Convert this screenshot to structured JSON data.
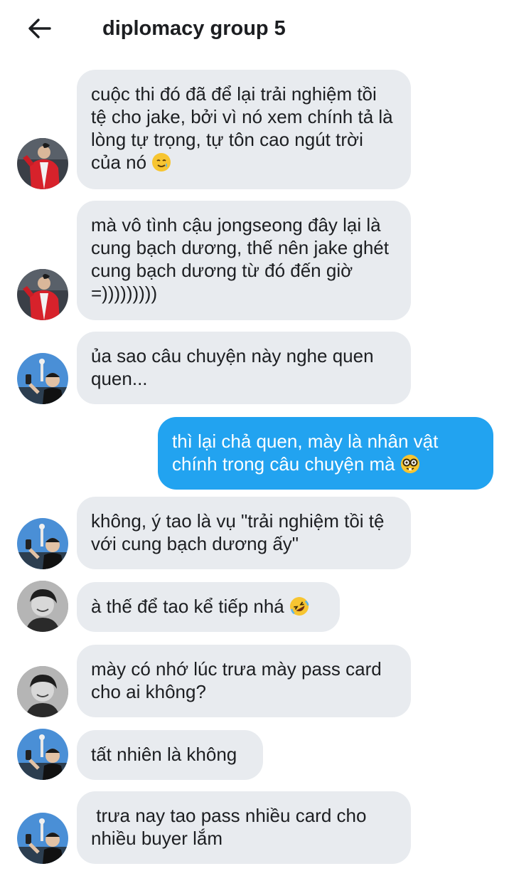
{
  "header": {
    "title": "diplomacy group 5"
  },
  "messages": [
    {
      "side": "in",
      "avatar": "red-jacket-avatar",
      "text": "cuộc thi đó đã để lại trải nghiệm tồi tệ cho jake, bởi vì nó xem chính tả là lòng tự trọng, tự tôn cao ngút trời của nó",
      "emoji": "smiling-face-with-tear-emoji"
    },
    {
      "side": "in",
      "avatar": "red-jacket-avatar",
      "text": "mà vô tình cậu jongseong đây lại là cung bạch dương, thế nên jake ghét cung bạch dương từ đó đến giờ =)))))))))"
    },
    {
      "side": "in",
      "avatar": "tower-selfie-avatar",
      "text": "ủa sao câu chuyện này nghe quen quen..."
    },
    {
      "side": "out",
      "text": "thì lại chả quen, mày là nhân vật chính trong câu chuyện mà",
      "emoji": "nerd-face-emoji"
    },
    {
      "side": "in",
      "avatar": "tower-selfie-avatar",
      "text": "không, ý tao là vụ \"trải nghiệm tồi tệ với cung bạch dương ấy\""
    },
    {
      "side": "in",
      "avatar": "bw-portrait-avatar",
      "text": "à thế để tao kể tiếp nhá",
      "emoji": "rolling-laughing-emoji"
    },
    {
      "side": "in",
      "avatar": "bw-portrait-avatar",
      "text": "mày có nhớ lúc trưa mày pass card cho ai không?"
    },
    {
      "side": "in",
      "avatar": "tower-selfie-avatar",
      "text": "tất nhiên là không"
    },
    {
      "side": "in",
      "avatar": "tower-selfie-avatar",
      "text": " trưa nay tao pass nhiều card cho nhiều buyer lắm"
    }
  ],
  "colors": {
    "incoming_bubble": "#e8ebef",
    "outgoing_bubble": "#22a3f0",
    "text": "#1c1e21"
  }
}
